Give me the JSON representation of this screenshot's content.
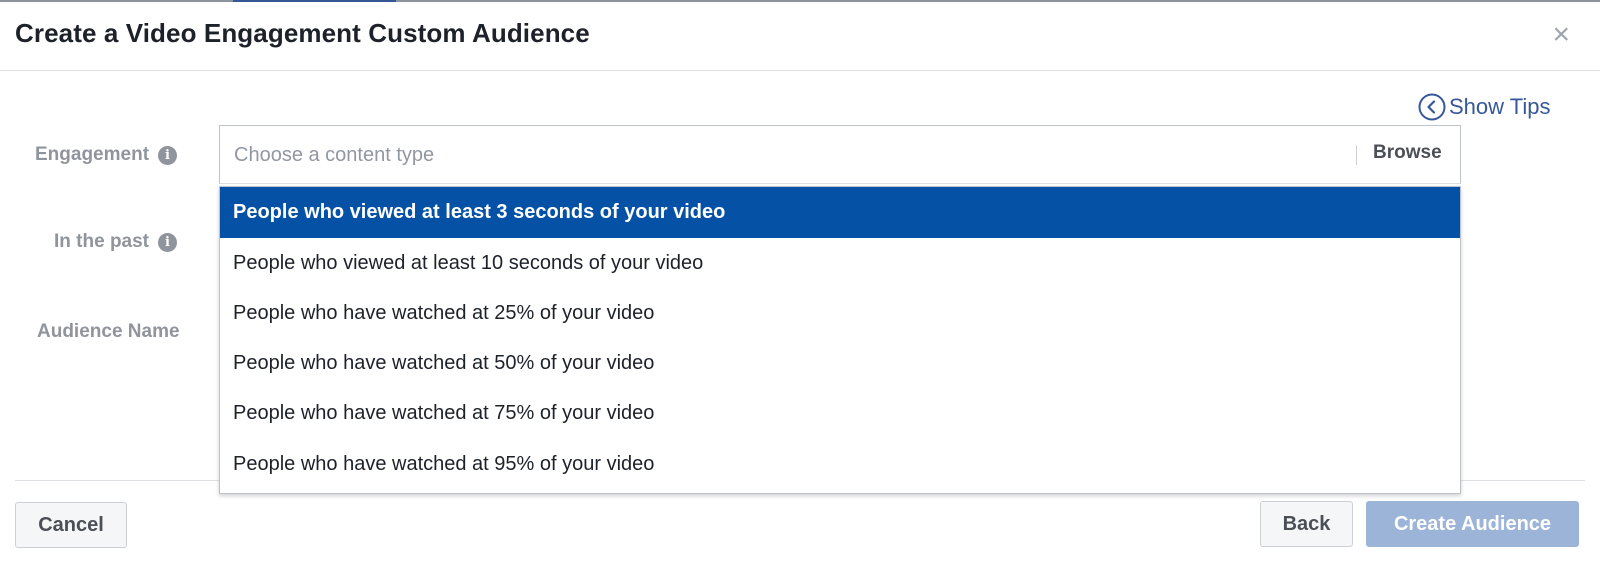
{
  "dialog": {
    "title": "Create a Video Engagement Custom Audience",
    "close_symbol": "×"
  },
  "tips": {
    "label": "Show Tips",
    "icon": "chevron-left-circle-icon"
  },
  "form": {
    "engagement_label": "Engagement",
    "past_label": "In the past",
    "audience_name_label": "Audience Name",
    "info_symbol": "i",
    "content_type": {
      "placeholder": "Choose a content type",
      "browse_label": "Browse"
    }
  },
  "dropdown": {
    "options": [
      {
        "label": "People who viewed at least 3 seconds of your video",
        "selected": true
      },
      {
        "label": "People who viewed at least 10 seconds of your video",
        "selected": false
      },
      {
        "label": "People who have watched at 25% of your video",
        "selected": false
      },
      {
        "label": "People who have watched at 50% of your video",
        "selected": false
      },
      {
        "label": "People who have watched at 75% of your video",
        "selected": false
      },
      {
        "label": "People who have watched at 95% of your video",
        "selected": false
      }
    ]
  },
  "footer": {
    "cancel_label": "Cancel",
    "back_label": "Back",
    "create_label": "Create Audience"
  },
  "colors": {
    "accent": "#365899",
    "selected_bg": "#0551a6",
    "disabled_primary": "#9cb4d8"
  }
}
